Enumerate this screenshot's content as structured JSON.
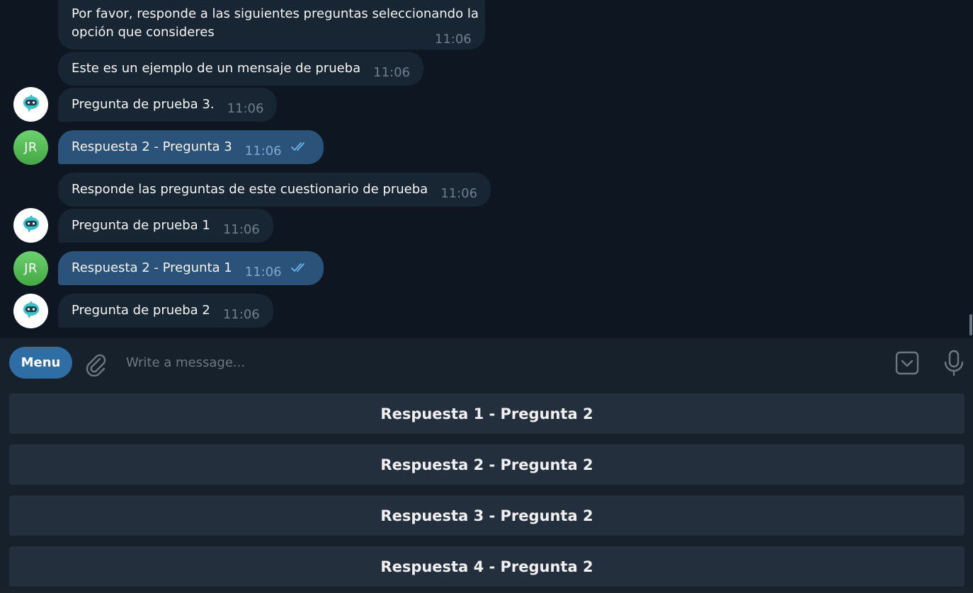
{
  "messages": [
    {
      "sender": "bot",
      "text": "Por favor, responde a las siguientes preguntas seleccionando la\nopción que consideres",
      "time": "11:06"
    },
    {
      "sender": "bot",
      "text": "Este es un ejemplo de un mensaje de prueba",
      "time": "11:06"
    },
    {
      "sender": "bot",
      "text": "Pregunta de prueba 3.",
      "time": "11:06"
    },
    {
      "sender": "user",
      "text": "Respuesta 2 - Pregunta 3",
      "time": "11:06",
      "status": "read"
    },
    {
      "sender": "bot",
      "text": "Responde las preguntas de este cuestionario de prueba",
      "time": "11:06"
    },
    {
      "sender": "bot",
      "text": "Pregunta de prueba 1",
      "time": "11:06"
    },
    {
      "sender": "user",
      "text": "Respuesta 2 - Pregunta 1",
      "time": "11:06",
      "status": "read"
    },
    {
      "sender": "bot",
      "text": "Pregunta de prueba 2",
      "time": "11:06"
    }
  ],
  "user_avatar": {
    "initials": "JR",
    "color": "#52bb53"
  },
  "bot_avatar": {
    "icon": "robot-icon",
    "color": "#3cc1c8"
  },
  "composer": {
    "menu_label": "Menu",
    "placeholder": "Write a message...",
    "icons": [
      "paperclip-icon",
      "keyboard-toggle-icon",
      "microphone-icon"
    ]
  },
  "reply_keyboard": [
    "Respuesta 1 - Pregunta 2",
    "Respuesta 2 - Pregunta 2",
    "Respuesta 3 - Pregunta 2",
    "Respuesta 4 - Pregunta 2"
  ],
  "colors": {
    "background": "#0e1621",
    "incoming_bubble": "#182533",
    "outgoing_bubble": "#2b5278",
    "accent": "#2f6ea5",
    "keyboard_button": "#242f3d"
  }
}
